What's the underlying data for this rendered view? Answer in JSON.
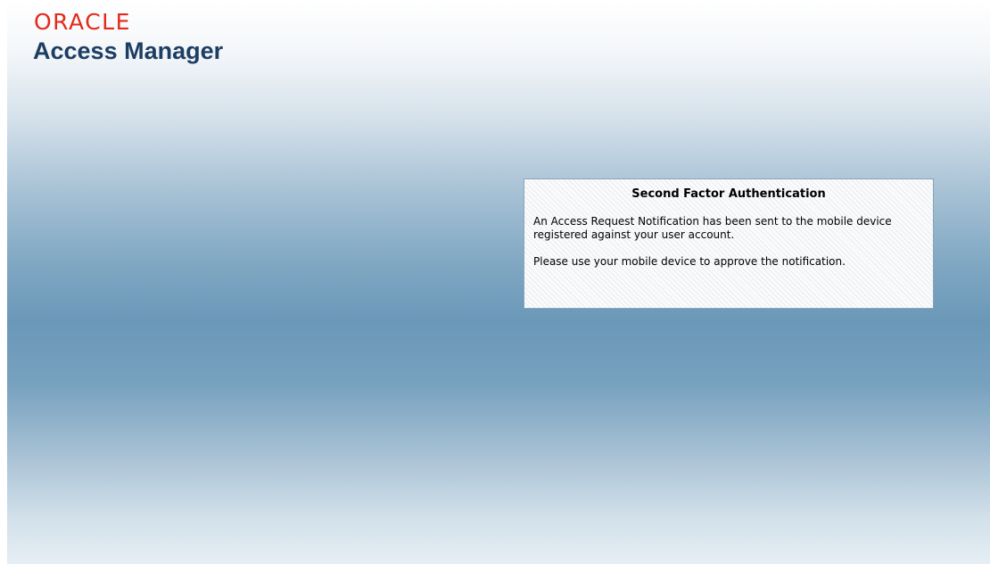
{
  "brand": {
    "logo_text": "ORACLE",
    "product_name": "Access Manager"
  },
  "auth": {
    "title": "Second Factor Authentication",
    "message_1": "An Access Request Notification has been sent to the mobile device registered against your user account.",
    "message_2": "Please use your mobile device to approve the notification."
  },
  "colors": {
    "logo_red": "#e32a1c",
    "product_navy": "#1d3e63",
    "background_blue": "#6b98b8"
  }
}
